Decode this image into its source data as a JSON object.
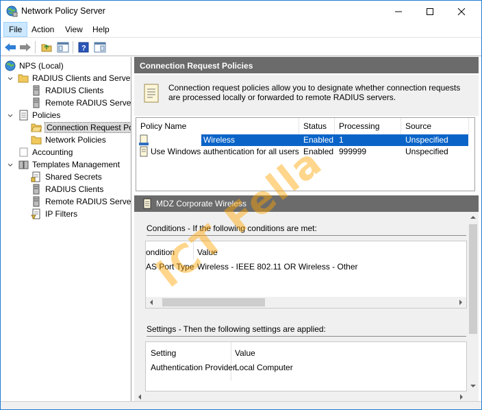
{
  "window": {
    "title": "Network Policy Server"
  },
  "menu": {
    "items": [
      "File",
      "Action",
      "View",
      "Help"
    ]
  },
  "tree": {
    "items": [
      {
        "label": "NPS (Local)"
      },
      {
        "label": "RADIUS Clients and Servers"
      },
      {
        "label": "RADIUS Clients"
      },
      {
        "label": "Remote RADIUS Server G"
      },
      {
        "label": "Policies"
      },
      {
        "label": "Connection Request Pol"
      },
      {
        "label": "Network Policies"
      },
      {
        "label": "Accounting"
      },
      {
        "label": "Templates Management"
      },
      {
        "label": "Shared Secrets"
      },
      {
        "label": "RADIUS Clients"
      },
      {
        "label": "Remote RADIUS Servers"
      },
      {
        "label": "IP Filters"
      }
    ]
  },
  "pane": {
    "header": "Connection Request Policies",
    "info": "Connection request policies allow you to designate whether connection requests are processed locally or forwarded to remote RADIUS servers.",
    "columns": [
      "Policy Name",
      "Status",
      "Processing Order",
      "Source"
    ],
    "rows": [
      {
        "name": "Wireless",
        "status": "Enabled",
        "order": "1",
        "source": "Unspecified"
      },
      {
        "name": "Use Windows authentication for all users",
        "status": "Enabled",
        "order": "999999",
        "source": "Unspecified"
      }
    ]
  },
  "details": {
    "band_title": "MDZ Corporate Wireless",
    "conditions_title": "Conditions - If the following conditions are met:",
    "conditions_columns": [
      "ondition",
      "Value"
    ],
    "conditions_rows": [
      {
        "condition": "AS Port Type",
        "value": "Wireless - IEEE 802.11 OR Wireless - Other"
      }
    ],
    "settings_title": "Settings - Then the following settings are applied:",
    "settings_columns": [
      "Setting",
      "Value"
    ],
    "settings_rows": [
      {
        "setting": "Authentication Provider",
        "value": "Local Computer"
      }
    ]
  },
  "watermark": "ICT Fella",
  "colors": {
    "selection": "#0a64c8",
    "header_band": "#6b6b6b",
    "window_border": "#1e7ad6"
  }
}
